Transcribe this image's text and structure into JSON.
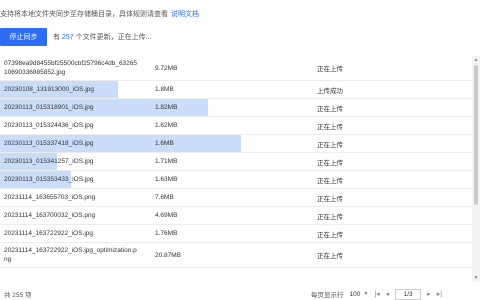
{
  "notice": {
    "text": "支持将本地文件夹同步至存储桶目录，具体规则请查看",
    "link": "说明文档"
  },
  "toolbar": {
    "stop_label": "停止同步",
    "status_prefix": "有",
    "file_count": "257",
    "status_suffix": "个文件更新，正在上传..."
  },
  "rows": [
    {
      "name": "07398ea9d8455bf25500cbf25796c4db_63265\n10690336885852.jpg",
      "size": "9.72MB",
      "status": "正在上传",
      "progress": 0
    },
    {
      "name": "20230108_131913000_iOS.jpg",
      "size": "1.8MB",
      "status": "上传成功",
      "progress": 0.25
    },
    {
      "name": "20230113_015318901_iOS.jpg",
      "size": "1.82MB",
      "status": "正在上传",
      "progress": 0.44
    },
    {
      "name": "20230113_015324436_iOS.jpg",
      "size": "1.62MB",
      "status": "正在上传",
      "progress": 0
    },
    {
      "name": "20230113_015337418_iOS.jpg",
      "size": "1.6MB",
      "status": "正在上传",
      "progress": 0.51
    },
    {
      "name": "20230113_015341257_iOS.jpg",
      "size": "1.71MB",
      "status": "正在上传",
      "progress": 0.12
    },
    {
      "name": "20230113_015353433_iOS.jpg",
      "size": "1.63MB",
      "status": "正在上传",
      "progress": 0.15
    },
    {
      "name": "20231114_163655703_iOS.png",
      "size": "7.6MB",
      "status": "正在上传",
      "progress": 0
    },
    {
      "name": "20231114_163700032_iOS.png",
      "size": "4.69MB",
      "status": "正在上传",
      "progress": 0
    },
    {
      "name": "20231114_163722922_iOS.jpg",
      "size": "1.76MB",
      "status": "正在上传",
      "progress": 0
    },
    {
      "name": "20231114_163722922_iOS.jpg_optimization.p\nng",
      "size": "20.87MB",
      "status": "正在上传",
      "progress": 0
    }
  ],
  "footer": {
    "total": "共 255 项",
    "page_size_label": "每页显示行",
    "page_size": "100",
    "page_input": "1/3"
  },
  "icons": {
    "caret": "▼",
    "first": "|◂",
    "prev": "◂",
    "next": "▸",
    "last": "▸|",
    "scroll_up": "▲",
    "scroll_down": "▼"
  },
  "colors": {
    "accent": "#2d6df6",
    "progress": "#c9dcfa"
  }
}
